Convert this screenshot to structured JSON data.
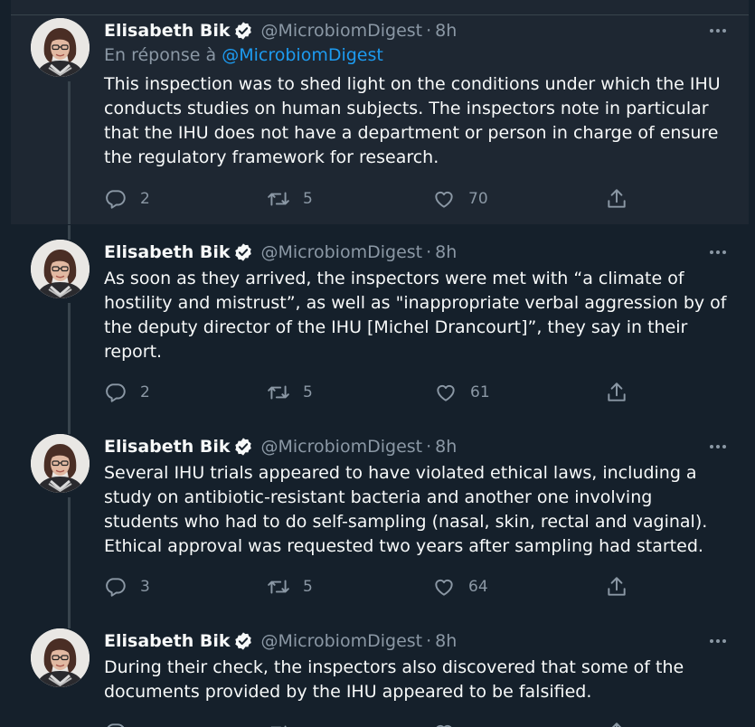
{
  "reply_prefix": "En réponse à",
  "reply_mention": "@MicrobiomDigest",
  "author": {
    "name": "Elisabeth Bik",
    "handle": "@MicrobiomDigest",
    "separator": "·"
  },
  "icons": {
    "verified": "verified-badge-icon",
    "more": "more-icon",
    "reply": "reply-icon",
    "retweet": "retweet-icon",
    "like": "like-icon",
    "share": "share-icon"
  },
  "colors": {
    "background": "#15202b",
    "highlight": "#1e2732",
    "mention": "#1d9bf0",
    "muted": "#8b98a5"
  },
  "tweets": [
    {
      "time": "8h",
      "text": "This inspection was to shed light on the conditions under which the IHU conducts studies on human subjects. The inspectors note in particular that the IHU does not have a department or person in charge of ensure the regulatory framework for research.",
      "replies": "2",
      "retweets": "5",
      "likes": "70"
    },
    {
      "time": "8h",
      "text": "As soon as they arrived, the inspectors were met with “a climate of hostility and mistrust”, as well as \"inappropriate verbal aggression by of the deputy director of the IHU [Michel Drancourt]”, they say in their report.",
      "replies": "2",
      "retweets": "5",
      "likes": "61"
    },
    {
      "time": "8h",
      "text": "Several IHU trials appeared to have violated ethical laws, including a study on antibiotic-resistant bacteria and another one involving students who had to do self-sampling (nasal, skin, rectal and vaginal).\nEthical approval was requested two years after sampling had started.",
      "replies": "3",
      "retweets": "5",
      "likes": "64"
    },
    {
      "time": "8h",
      "text": "During their check, the inspectors also discovered that some of the documents provided by the IHU appeared to be falsified.",
      "replies": "",
      "retweets": "",
      "likes": ""
    }
  ]
}
